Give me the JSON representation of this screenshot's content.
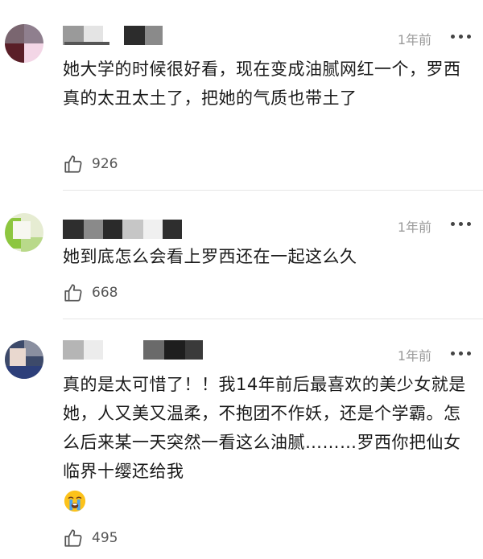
{
  "comments": [
    {
      "time": "1年前",
      "text": "她大学的时候很好看，现在变成油腻网红一个，罗西真的太丑太土了，把她的气质也带土了",
      "likes": "926"
    },
    {
      "time": "1年前",
      "text": "她到底怎么会看上罗西还在一起这么久",
      "likes": "668"
    },
    {
      "time": "1年前",
      "text": "真的是太可惜了！！我14年前后最喜欢的美少女就是她，人又美又温柔，不抱团不作妖，还是个学霸。怎么后来某一天突然一看这么油腻………罗西你把仙女临界十缨还给我",
      "emoji": "loudly-crying-face-emoji",
      "likes": "495"
    }
  ],
  "icons": {
    "like": "thumbs-up-icon",
    "more": "more-dots-icon"
  },
  "colors": {
    "time": "#9a9a9a",
    "divider": "#e6e6e6",
    "text": "#1a1a1a"
  }
}
